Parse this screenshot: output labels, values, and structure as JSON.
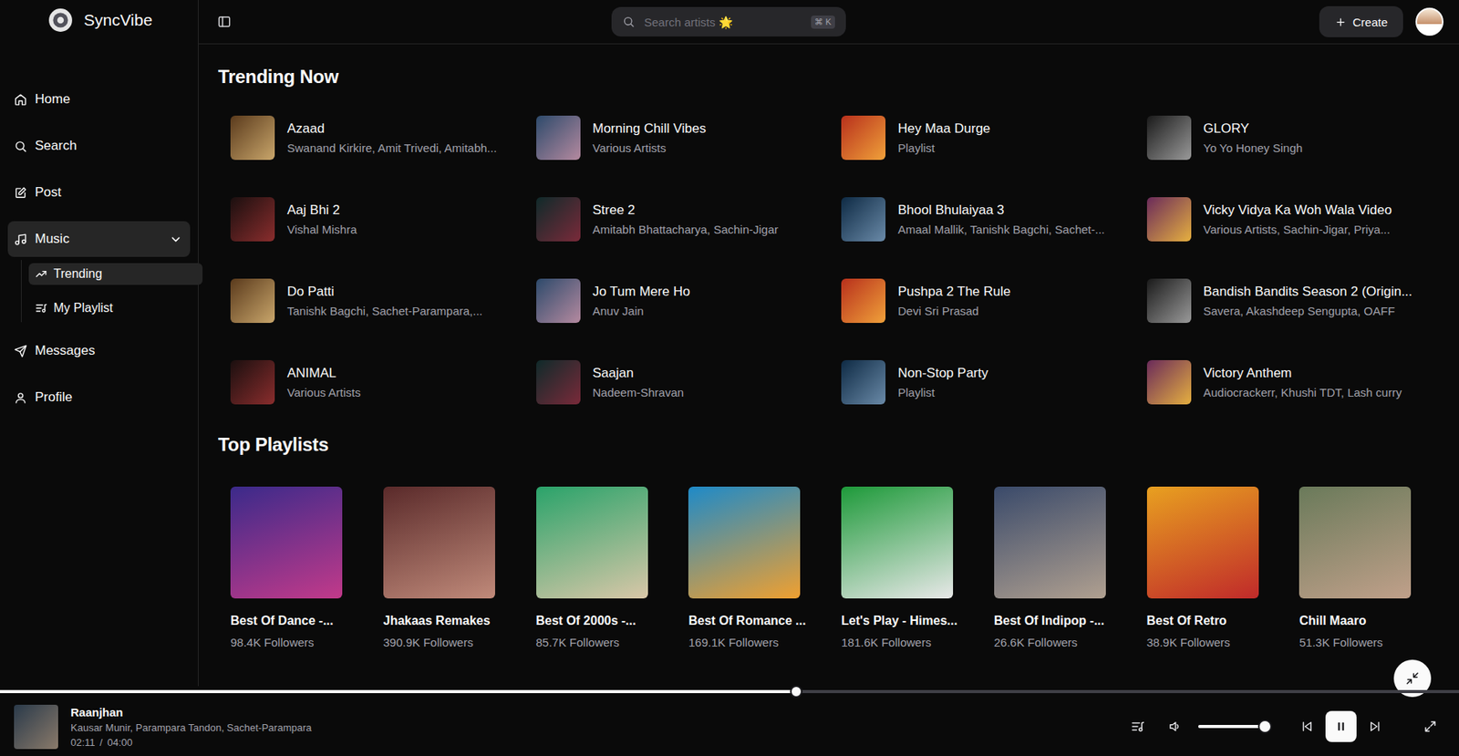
{
  "app": {
    "name": "SyncVibe"
  },
  "sidebar": {
    "items": [
      {
        "label": "Home",
        "selected": false,
        "expanded": false,
        "children": []
      },
      {
        "label": "Search",
        "selected": false,
        "expanded": false,
        "children": []
      },
      {
        "label": "Post",
        "selected": false,
        "expanded": false,
        "children": []
      },
      {
        "label": "Music",
        "selected": true,
        "expanded": true,
        "children": [
          {
            "label": "Trending",
            "selected": true
          },
          {
            "label": "My Playlist",
            "selected": false
          }
        ]
      },
      {
        "label": "Messages",
        "selected": false,
        "expanded": false,
        "children": []
      },
      {
        "label": "Profile",
        "selected": false,
        "expanded": false,
        "children": []
      }
    ]
  },
  "header": {
    "search": {
      "placeholder": "Search artists 🌟",
      "shortcut": "⌘ K"
    },
    "create_button": "Create"
  },
  "trending": {
    "title": "Trending Now",
    "items": [
      {
        "title": "Azaad",
        "subtitle": "Swanand Kirkire, Amit Trivedi, Amitabh..."
      },
      {
        "title": "Morning Chill Vibes",
        "subtitle": "Various Artists"
      },
      {
        "title": "Hey Maa Durge",
        "subtitle": "Playlist"
      },
      {
        "title": "GLORY",
        "subtitle": "Yo Yo Honey Singh"
      },
      {
        "title": "Aaj Bhi 2",
        "subtitle": "Vishal Mishra"
      },
      {
        "title": "Stree 2",
        "subtitle": "Amitabh Bhattacharya, Sachin-Jigar"
      },
      {
        "title": "Bhool Bhulaiyaa 3",
        "subtitle": "Amaal Mallik, Tanishk Bagchi, Sachet-..."
      },
      {
        "title": "Vicky Vidya Ka Woh Wala Video",
        "subtitle": "Various Artists, Sachin-Jigar, Priya..."
      },
      {
        "title": "Do Patti",
        "subtitle": "Tanishk Bagchi, Sachet-Parampara,..."
      },
      {
        "title": "Jo Tum Mere Ho",
        "subtitle": "Anuv Jain"
      },
      {
        "title": "Pushpa 2 The Rule",
        "subtitle": "Devi Sri Prasad"
      },
      {
        "title": "Bandish Bandits Season 2 (Origin...",
        "subtitle": "Savera, Akashdeep Sengupta, OAFF"
      },
      {
        "title": "ANIMAL",
        "subtitle": "Various Artists"
      },
      {
        "title": "Saajan",
        "subtitle": "Nadeem-Shravan"
      },
      {
        "title": "Non-Stop Party",
        "subtitle": "Playlist"
      },
      {
        "title": "Victory Anthem",
        "subtitle": "Audiocrackerr, Khushi TDT, Lash curry"
      }
    ]
  },
  "playlists": {
    "title": "Top Playlists",
    "items": [
      {
        "title": "Best Of Dance -...",
        "followers": "98.4K Followers"
      },
      {
        "title": "Jhakaas Remakes",
        "followers": "390.9K Followers"
      },
      {
        "title": "Best Of 2000s -...",
        "followers": "85.7K Followers"
      },
      {
        "title": "Best Of Romance ...",
        "followers": "169.1K Followers"
      },
      {
        "title": "Let's Play - Himes...",
        "followers": "181.6K Followers"
      },
      {
        "title": "Best Of Indipop -...",
        "followers": "26.6K Followers"
      },
      {
        "title": "Best Of Retro",
        "followers": "38.9K Followers"
      },
      {
        "title": "Chill Maaro",
        "followers": "51.3K Followers"
      }
    ]
  },
  "player": {
    "title": "Raanjhan",
    "artists": "Kausar Munir, Parampara Tandon, Sachet-Parampara",
    "elapsed": "02:11",
    "separator": "/",
    "duration": "04:00",
    "level": 0.546,
    "playing": true,
    "volume": {
      "level": 1.0
    }
  }
}
